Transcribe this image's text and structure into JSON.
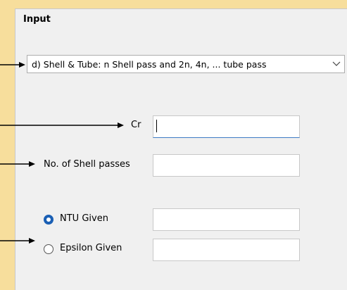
{
  "group": {
    "title": "Input"
  },
  "combo": {
    "selected": "d) Shell & Tube: n Shell pass and 2n, 4n, ... tube pass"
  },
  "fields": {
    "cr_label": "Cr",
    "cr_value": "",
    "shell_passes_label": "No. of Shell passes",
    "shell_passes_value": ""
  },
  "options": {
    "ntu_label": "NTU Given",
    "ntu_selected": true,
    "ntu_value": "",
    "epsilon_label": "Epsilon Given",
    "epsilon_selected": false,
    "epsilon_value": ""
  },
  "colors": {
    "background": "#f7de9c",
    "panel": "#f0f0f0",
    "radio_selected": "#1a5fb4",
    "focus_border": "#3d7bc4"
  },
  "icons": {
    "dropdown": "chevron-down-icon",
    "annotation": "arrow-right-icon"
  }
}
